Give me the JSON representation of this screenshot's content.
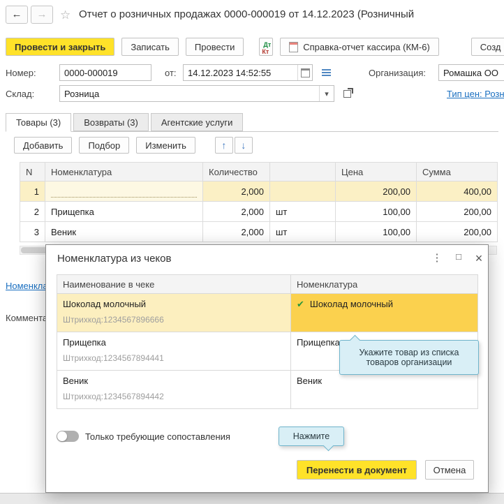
{
  "colors": {
    "accent_yellow": "#ffe229",
    "selection_yellow": "#fbf0c5",
    "match_gold": "#fbd14e",
    "tooltip_blue": "#d9eff6",
    "link_blue": "#1a6fc0",
    "check_green": "#27963c"
  },
  "titlebar": {
    "title": "Отчет о розничных продажах 0000-000019 от 14.12.2023 (Розничный",
    "back_icon": "←",
    "forward_icon": "→",
    "star_icon": "☆"
  },
  "toolbar": {
    "post_and_close": "Провести и закрыть",
    "write": "Записать",
    "post": "Провести",
    "dt": "Дт",
    "kt": "Кт",
    "cashier_report": "Справка-отчет кассира (КМ-6)",
    "create": "Созд"
  },
  "form": {
    "number_label": "Номер:",
    "number_value": "0000-000019",
    "date_label": "от:",
    "date_value": "14.12.2023 14:52:55",
    "org_label": "Организация:",
    "org_value": "Ромашка ОО",
    "warehouse_label": "Склад:",
    "warehouse_value": "Розница",
    "dropdown_icon": "▾",
    "price_type_link": "Тип цен: Розн",
    "nomenclature_link": "Номенклатура",
    "comment_label": "Комментарий"
  },
  "tabs": [
    {
      "label": "Товары (3)"
    },
    {
      "label": "Возвраты (3)"
    },
    {
      "label": "Агентские услуги"
    }
  ],
  "table_toolbar": {
    "add": "Добавить",
    "pick": "Подбор",
    "edit": "Изменить",
    "up_icon": "↑",
    "down_icon": "↓"
  },
  "goods_table": {
    "headers": {
      "n": "N",
      "name": "Номенклатура",
      "qty": "Количество",
      "unit": "",
      "price": "Цена",
      "sum": "Сумма"
    },
    "rows": [
      {
        "n": "1",
        "name": "",
        "qty": "2,000",
        "unit": "",
        "price": "200,00",
        "sum": "400,00"
      },
      {
        "n": "2",
        "name": "Прищепка",
        "qty": "2,000",
        "unit": "шт",
        "price": "100,00",
        "sum": "200,00"
      },
      {
        "n": "3",
        "name": "Веник",
        "qty": "2,000",
        "unit": "шт",
        "price": "100,00",
        "sum": "200,00"
      }
    ]
  },
  "modal": {
    "title": "Номенклатура из чеков",
    "menu_icon": "⋮",
    "maximize_icon": "□",
    "close_icon": "×",
    "check_icon": "✔",
    "table": {
      "name_header": "Наименование в чеке",
      "nomen_header": "Номенклатура",
      "rows": [
        {
          "name": "Шоколад молочный",
          "barcode": "Штрихкод:1234567896666",
          "match": "Шоколад молочный"
        },
        {
          "name": "Прищепка",
          "barcode": "Штрихкод:1234567894441",
          "match": "Прищепка"
        },
        {
          "name": "Веник",
          "barcode": "Штрихкод:1234567894442",
          "match": "Веник"
        }
      ]
    },
    "toggle_label": "Только требующие сопоставления",
    "tip_select": "Укажите товар из списка товаров организации",
    "tip_click": "Нажмите",
    "transfer_button": "Перенести в документ",
    "cancel_button": "Отмена"
  }
}
